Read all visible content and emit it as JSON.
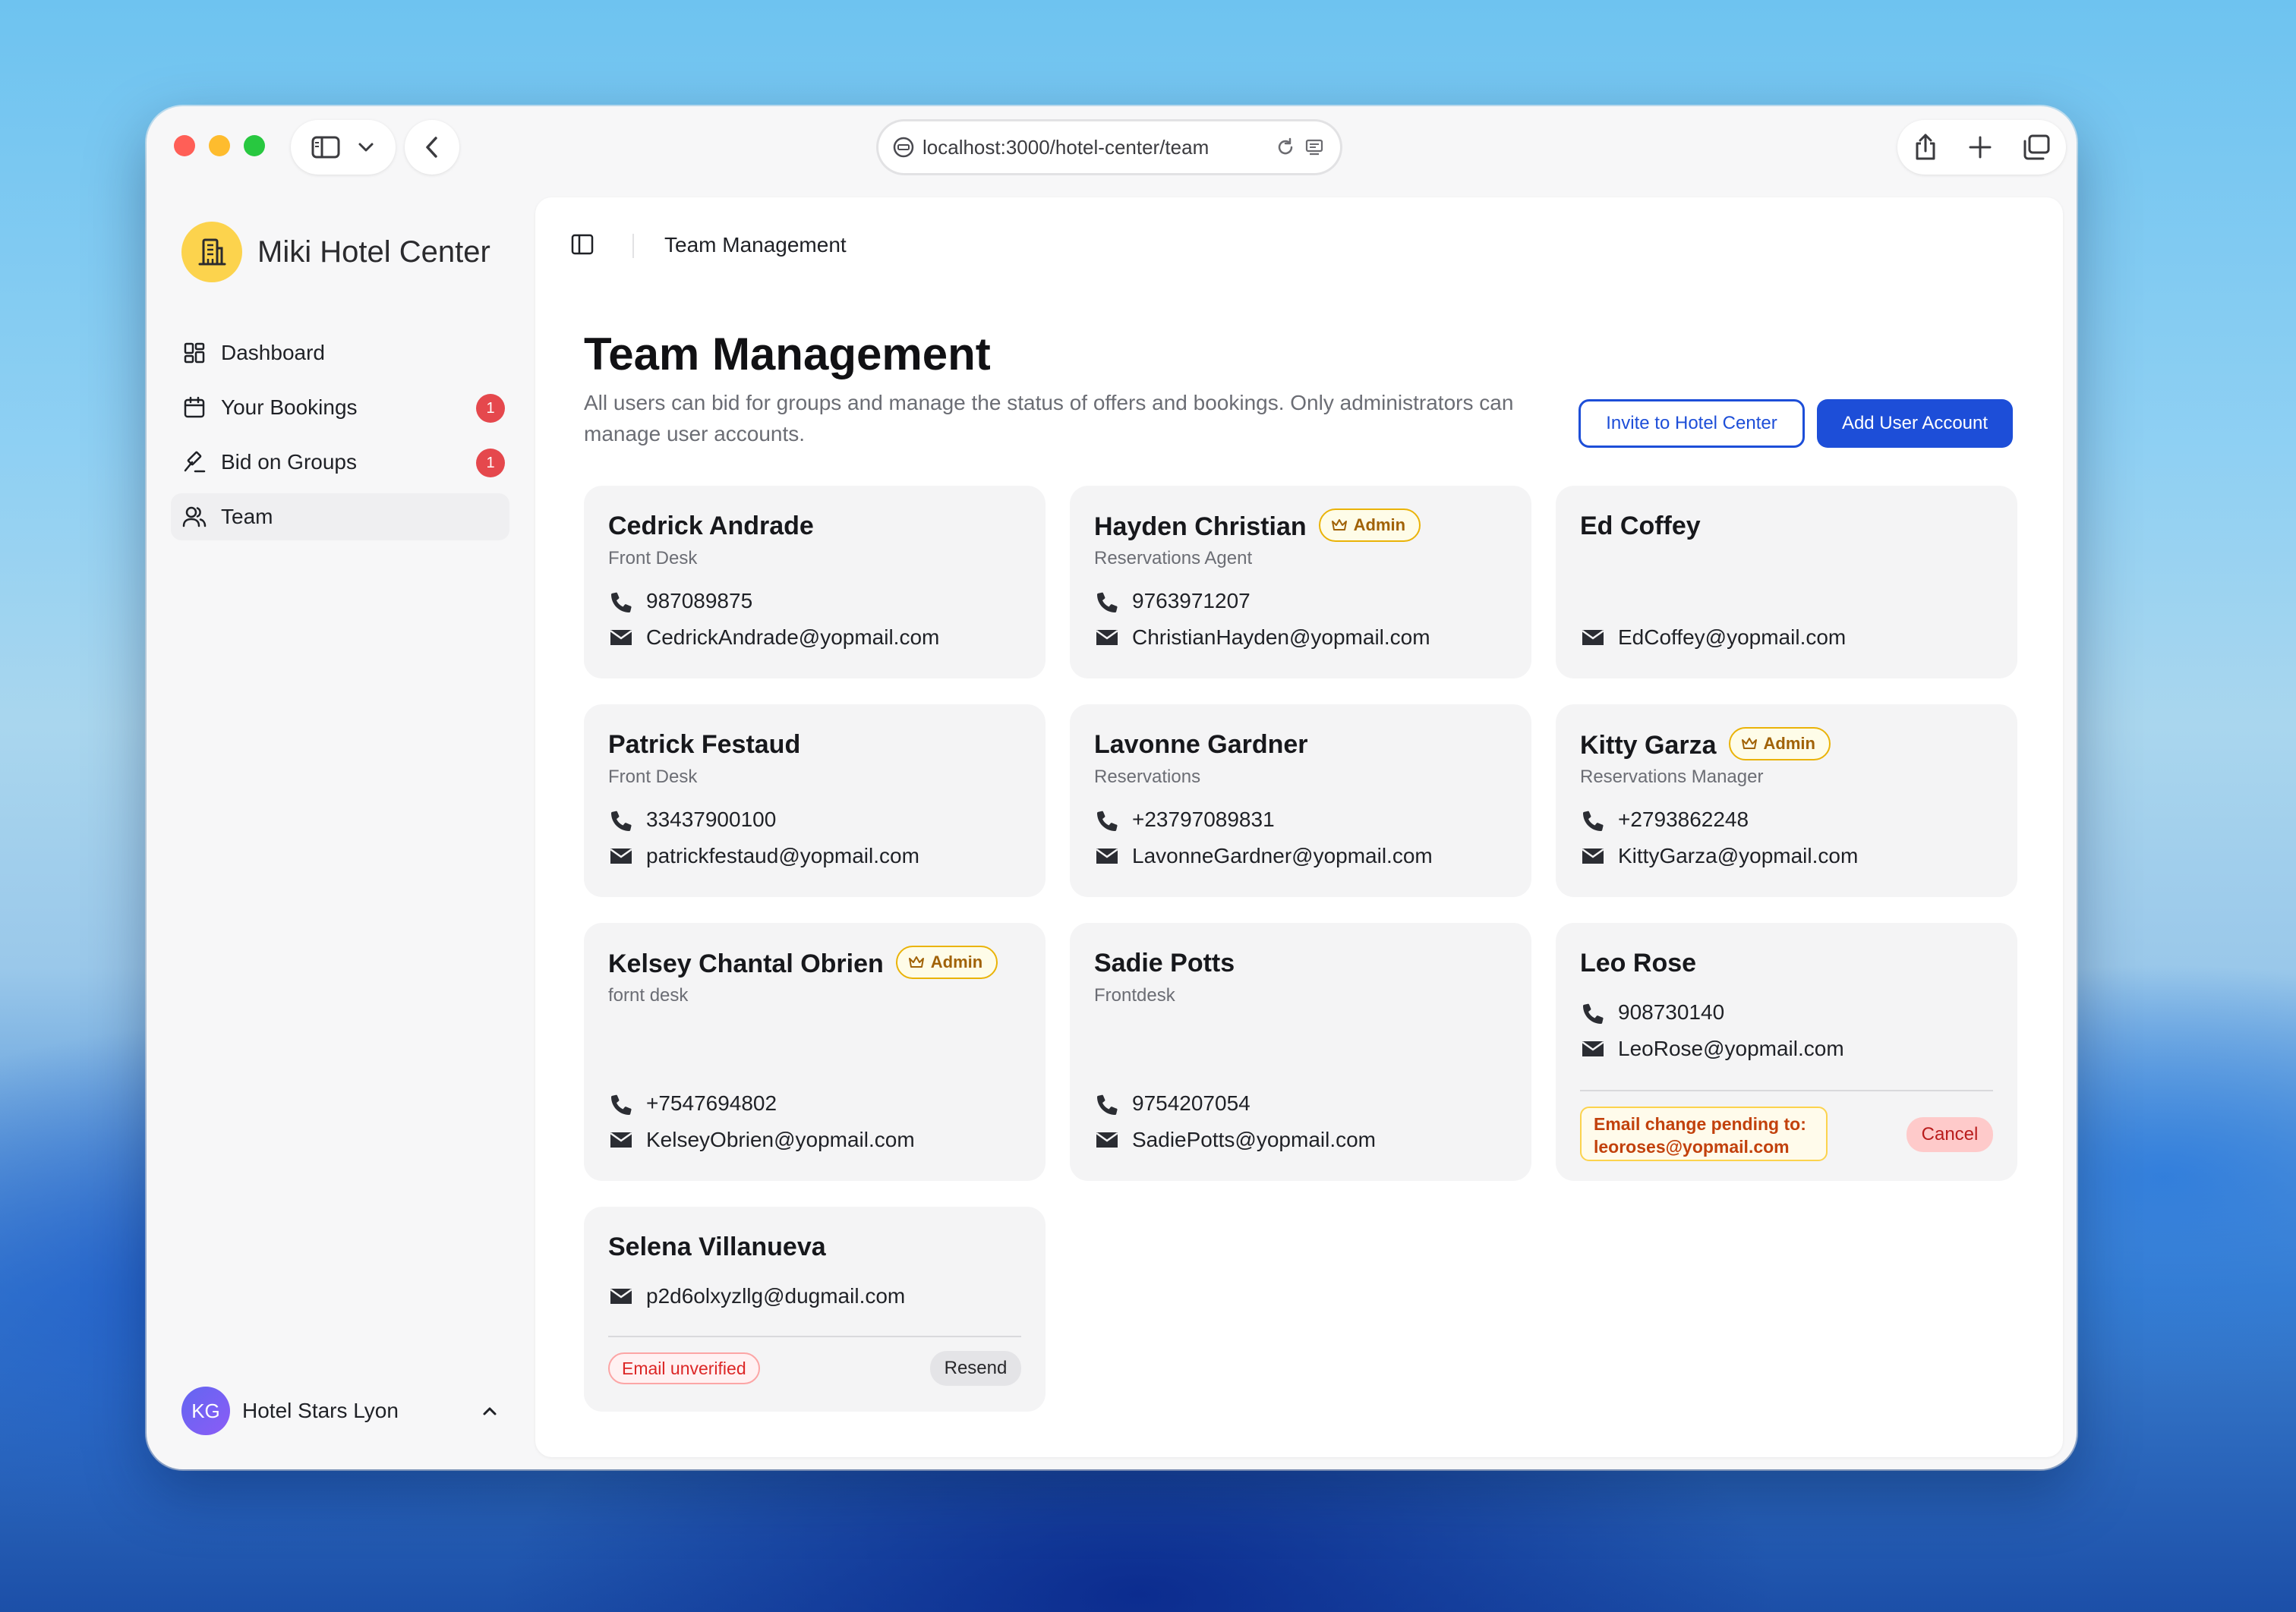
{
  "browser": {
    "url": "localhost:3000/hotel-center/team"
  },
  "sidebar": {
    "brand": "Miki Hotel Center",
    "items": [
      {
        "label": "Dashboard",
        "icon": "dashboard-icon"
      },
      {
        "label": "Your Bookings",
        "icon": "calendar-icon",
        "badge": "1"
      },
      {
        "label": "Bid on Groups",
        "icon": "gavel-icon",
        "badge": "1"
      },
      {
        "label": "Team",
        "icon": "users-icon",
        "active": true
      }
    ],
    "account": {
      "initials": "KG",
      "name": "Hotel Stars Lyon"
    }
  },
  "header": {
    "breadcrumb": "Team Management"
  },
  "page": {
    "title": "Team Management",
    "description": "All users can bid for groups and manage the status of offers and bookings. Only administrators can manage user accounts.",
    "invite_label": "Invite to Hotel Center",
    "add_label": "Add User Account"
  },
  "admin_label": "Admin",
  "members": [
    {
      "name": "Cedrick Andrade",
      "role": "Front Desk",
      "phone": "987089875",
      "email": "CedrickAndrade@yopmail.com"
    },
    {
      "name": "Hayden Christian",
      "role": "Reservations Agent",
      "phone": "9763971207",
      "email": "ChristianHayden@yopmail.com",
      "admin": true
    },
    {
      "name": "Ed Coffey",
      "email": "EdCoffey@yopmail.com"
    },
    {
      "name": "Patrick Festaud",
      "role": "Front Desk",
      "phone": "33437900100",
      "email": "patrickfestaud@yopmail.com"
    },
    {
      "name": "Lavonne Gardner",
      "role": "Reservations",
      "phone": "+23797089831",
      "email": "LavonneGardner@yopmail.com"
    },
    {
      "name": "Kitty Garza",
      "role": "Reservations Manager",
      "phone": "+2793862248",
      "email": "KittyGarza@yopmail.com",
      "admin": true
    },
    {
      "name": "Kelsey Chantal Obrien",
      "role": "fornt desk",
      "phone": "+7547694802",
      "email": "KelseyObrien@yopmail.com",
      "admin": true
    },
    {
      "name": "Sadie Potts",
      "role": "Frontdesk",
      "phone": "9754207054",
      "email": "SadiePotts@yopmail.com"
    },
    {
      "name": "Leo Rose",
      "phone": "908730140",
      "email": "LeoRose@yopmail.com",
      "pending_line1": "Email change pending to:",
      "pending_line2": "leoroses@yopmail.com",
      "cancel_label": "Cancel"
    },
    {
      "name": "Selena Villanueva",
      "email": "p2d6olxyzllg@dugmail.com",
      "unverified_label": "Email unverified",
      "resend_label": "Resend"
    }
  ]
}
